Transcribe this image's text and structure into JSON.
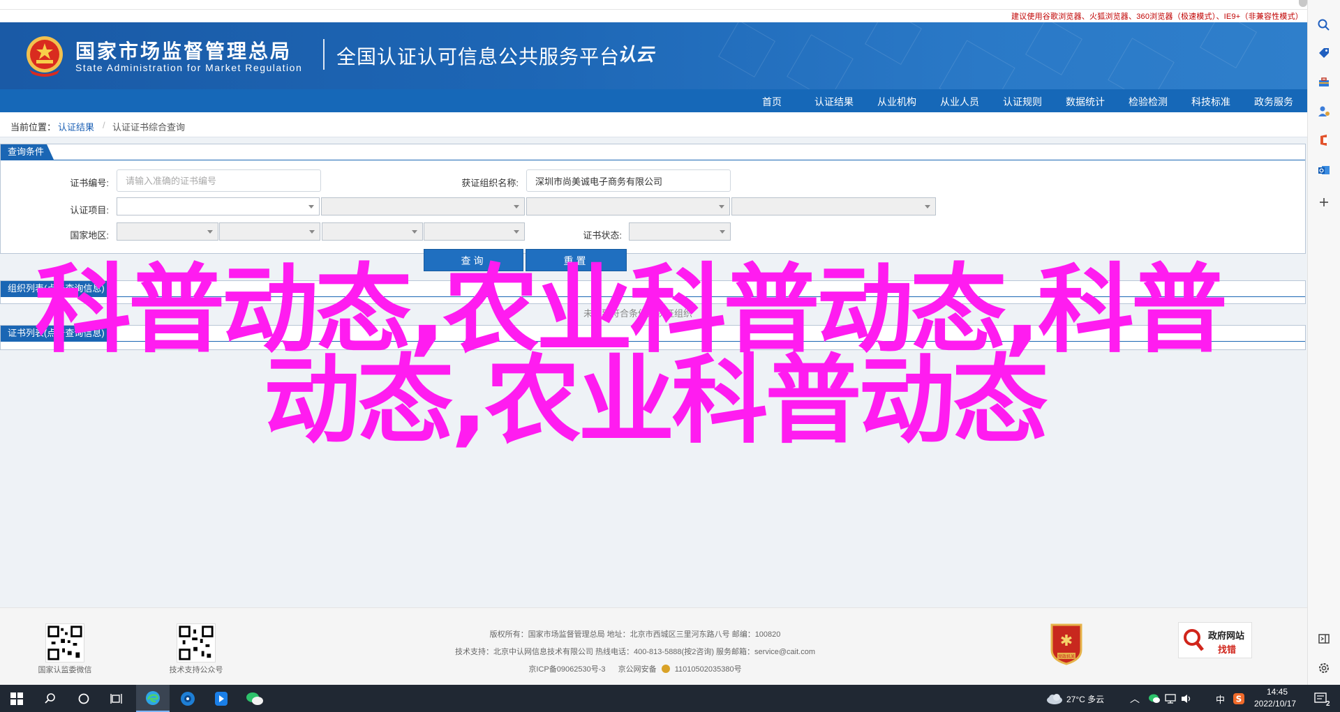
{
  "notice": "建议使用谷歌浏览器、火狐浏览器、360浏览器（极速模式）、IE9+（非兼容性模式）",
  "header": {
    "org_cn": "国家市场监督管理总局",
    "org_en": "State Administration  for  Market Regulation",
    "platform_title": "全国认证认可信息公共服务平台",
    "platform_logo": "认云"
  },
  "nav": {
    "items": [
      "首页",
      "认证结果",
      "从业机构",
      "从业人员",
      "认证规则",
      "数据统计",
      "检验检测",
      "科技标准",
      "政务服务"
    ]
  },
  "breadcrumb": {
    "prefix": "当前位置：",
    "link": "认证结果",
    "separator": "/",
    "current": "认证证书综合查询"
  },
  "query_panel": {
    "tab_label": "查询条件",
    "cert_no_label": "证书编号:",
    "cert_no_placeholder": "请输入准确的证书编号",
    "org_name_label": "获证组织名称:",
    "org_name_value": "深圳市尚美诚电子商务有限公司",
    "cert_item_label": "认证项目:",
    "region_label": "国家地区:",
    "status_label": "证书状态:",
    "query_button": "查询",
    "reset_button": "重置"
  },
  "org_list_panel": {
    "tab_label": "组织列表(点击查询信息)"
  },
  "cert_list_panel": {
    "tab_label": "证书列表(点击查询信息)",
    "no_data": "未找到符合条件的获证组织"
  },
  "overlay": {
    "line1": "科普动态,农业科普动态,科普",
    "line2": "动态,农业科普动态",
    "color": "#ff1cf0"
  },
  "footer": {
    "qr_left_caption": "国家认监委微信",
    "qr_right_caption": "技术支持公众号",
    "line1": "版权所有：国家市场监督管理总局    地址：北京市西城区三里河东路八号    邮编：100820",
    "line2": "技术支持：北京中认网信息技术有限公司    热线电话：400-813-5888(按2咨询)    服务邮箱：service@cait.com",
    "icp": "京ICP备09062530号-3",
    "police_prefix": "京公网安备",
    "police_no": "11010502035380号",
    "party_badge_text": "党政机关",
    "gov_badge_line1": "政府网站",
    "gov_badge_line2": "找错"
  },
  "sidebar_icons": [
    "search-icon",
    "tag-icon",
    "toolbox-icon",
    "person-icon",
    "office-icon",
    "outlook-icon",
    "add-icon",
    "panel-icon",
    "settings-icon"
  ],
  "taskbar": {
    "weather": "27°C 多云",
    "ime": "中",
    "time": "14:45",
    "date": "2022/10/17",
    "notification_count": "2"
  }
}
